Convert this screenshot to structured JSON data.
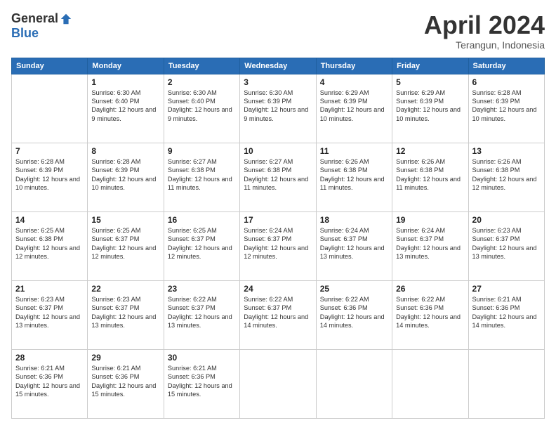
{
  "logo": {
    "general": "General",
    "blue": "Blue"
  },
  "title": "April 2024",
  "location": "Terangun, Indonesia",
  "days_of_week": [
    "Sunday",
    "Monday",
    "Tuesday",
    "Wednesday",
    "Thursday",
    "Friday",
    "Saturday"
  ],
  "weeks": [
    [
      {
        "day": "",
        "sunrise": "",
        "sunset": "",
        "daylight": ""
      },
      {
        "day": "1",
        "sunrise": "Sunrise: 6:30 AM",
        "sunset": "Sunset: 6:40 PM",
        "daylight": "Daylight: 12 hours and 9 minutes."
      },
      {
        "day": "2",
        "sunrise": "Sunrise: 6:30 AM",
        "sunset": "Sunset: 6:40 PM",
        "daylight": "Daylight: 12 hours and 9 minutes."
      },
      {
        "day": "3",
        "sunrise": "Sunrise: 6:30 AM",
        "sunset": "Sunset: 6:39 PM",
        "daylight": "Daylight: 12 hours and 9 minutes."
      },
      {
        "day": "4",
        "sunrise": "Sunrise: 6:29 AM",
        "sunset": "Sunset: 6:39 PM",
        "daylight": "Daylight: 12 hours and 10 minutes."
      },
      {
        "day": "5",
        "sunrise": "Sunrise: 6:29 AM",
        "sunset": "Sunset: 6:39 PM",
        "daylight": "Daylight: 12 hours and 10 minutes."
      },
      {
        "day": "6",
        "sunrise": "Sunrise: 6:28 AM",
        "sunset": "Sunset: 6:39 PM",
        "daylight": "Daylight: 12 hours and 10 minutes."
      }
    ],
    [
      {
        "day": "7",
        "sunrise": "Sunrise: 6:28 AM",
        "sunset": "Sunset: 6:39 PM",
        "daylight": "Daylight: 12 hours and 10 minutes."
      },
      {
        "day": "8",
        "sunrise": "Sunrise: 6:28 AM",
        "sunset": "Sunset: 6:39 PM",
        "daylight": "Daylight: 12 hours and 10 minutes."
      },
      {
        "day": "9",
        "sunrise": "Sunrise: 6:27 AM",
        "sunset": "Sunset: 6:38 PM",
        "daylight": "Daylight: 12 hours and 11 minutes."
      },
      {
        "day": "10",
        "sunrise": "Sunrise: 6:27 AM",
        "sunset": "Sunset: 6:38 PM",
        "daylight": "Daylight: 12 hours and 11 minutes."
      },
      {
        "day": "11",
        "sunrise": "Sunrise: 6:26 AM",
        "sunset": "Sunset: 6:38 PM",
        "daylight": "Daylight: 12 hours and 11 minutes."
      },
      {
        "day": "12",
        "sunrise": "Sunrise: 6:26 AM",
        "sunset": "Sunset: 6:38 PM",
        "daylight": "Daylight: 12 hours and 11 minutes."
      },
      {
        "day": "13",
        "sunrise": "Sunrise: 6:26 AM",
        "sunset": "Sunset: 6:38 PM",
        "daylight": "Daylight: 12 hours and 12 minutes."
      }
    ],
    [
      {
        "day": "14",
        "sunrise": "Sunrise: 6:25 AM",
        "sunset": "Sunset: 6:38 PM",
        "daylight": "Daylight: 12 hours and 12 minutes."
      },
      {
        "day": "15",
        "sunrise": "Sunrise: 6:25 AM",
        "sunset": "Sunset: 6:37 PM",
        "daylight": "Daylight: 12 hours and 12 minutes."
      },
      {
        "day": "16",
        "sunrise": "Sunrise: 6:25 AM",
        "sunset": "Sunset: 6:37 PM",
        "daylight": "Daylight: 12 hours and 12 minutes."
      },
      {
        "day": "17",
        "sunrise": "Sunrise: 6:24 AM",
        "sunset": "Sunset: 6:37 PM",
        "daylight": "Daylight: 12 hours and 12 minutes."
      },
      {
        "day": "18",
        "sunrise": "Sunrise: 6:24 AM",
        "sunset": "Sunset: 6:37 PM",
        "daylight": "Daylight: 12 hours and 13 minutes."
      },
      {
        "day": "19",
        "sunrise": "Sunrise: 6:24 AM",
        "sunset": "Sunset: 6:37 PM",
        "daylight": "Daylight: 12 hours and 13 minutes."
      },
      {
        "day": "20",
        "sunrise": "Sunrise: 6:23 AM",
        "sunset": "Sunset: 6:37 PM",
        "daylight": "Daylight: 12 hours and 13 minutes."
      }
    ],
    [
      {
        "day": "21",
        "sunrise": "Sunrise: 6:23 AM",
        "sunset": "Sunset: 6:37 PM",
        "daylight": "Daylight: 12 hours and 13 minutes."
      },
      {
        "day": "22",
        "sunrise": "Sunrise: 6:23 AM",
        "sunset": "Sunset: 6:37 PM",
        "daylight": "Daylight: 12 hours and 13 minutes."
      },
      {
        "day": "23",
        "sunrise": "Sunrise: 6:22 AM",
        "sunset": "Sunset: 6:37 PM",
        "daylight": "Daylight: 12 hours and 13 minutes."
      },
      {
        "day": "24",
        "sunrise": "Sunrise: 6:22 AM",
        "sunset": "Sunset: 6:37 PM",
        "daylight": "Daylight: 12 hours and 14 minutes."
      },
      {
        "day": "25",
        "sunrise": "Sunrise: 6:22 AM",
        "sunset": "Sunset: 6:36 PM",
        "daylight": "Daylight: 12 hours and 14 minutes."
      },
      {
        "day": "26",
        "sunrise": "Sunrise: 6:22 AM",
        "sunset": "Sunset: 6:36 PM",
        "daylight": "Daylight: 12 hours and 14 minutes."
      },
      {
        "day": "27",
        "sunrise": "Sunrise: 6:21 AM",
        "sunset": "Sunset: 6:36 PM",
        "daylight": "Daylight: 12 hours and 14 minutes."
      }
    ],
    [
      {
        "day": "28",
        "sunrise": "Sunrise: 6:21 AM",
        "sunset": "Sunset: 6:36 PM",
        "daylight": "Daylight: 12 hours and 15 minutes."
      },
      {
        "day": "29",
        "sunrise": "Sunrise: 6:21 AM",
        "sunset": "Sunset: 6:36 PM",
        "daylight": "Daylight: 12 hours and 15 minutes."
      },
      {
        "day": "30",
        "sunrise": "Sunrise: 6:21 AM",
        "sunset": "Sunset: 6:36 PM",
        "daylight": "Daylight: 12 hours and 15 minutes."
      },
      {
        "day": "",
        "sunrise": "",
        "sunset": "",
        "daylight": ""
      },
      {
        "day": "",
        "sunrise": "",
        "sunset": "",
        "daylight": ""
      },
      {
        "day": "",
        "sunrise": "",
        "sunset": "",
        "daylight": ""
      },
      {
        "day": "",
        "sunrise": "",
        "sunset": "",
        "daylight": ""
      }
    ]
  ]
}
